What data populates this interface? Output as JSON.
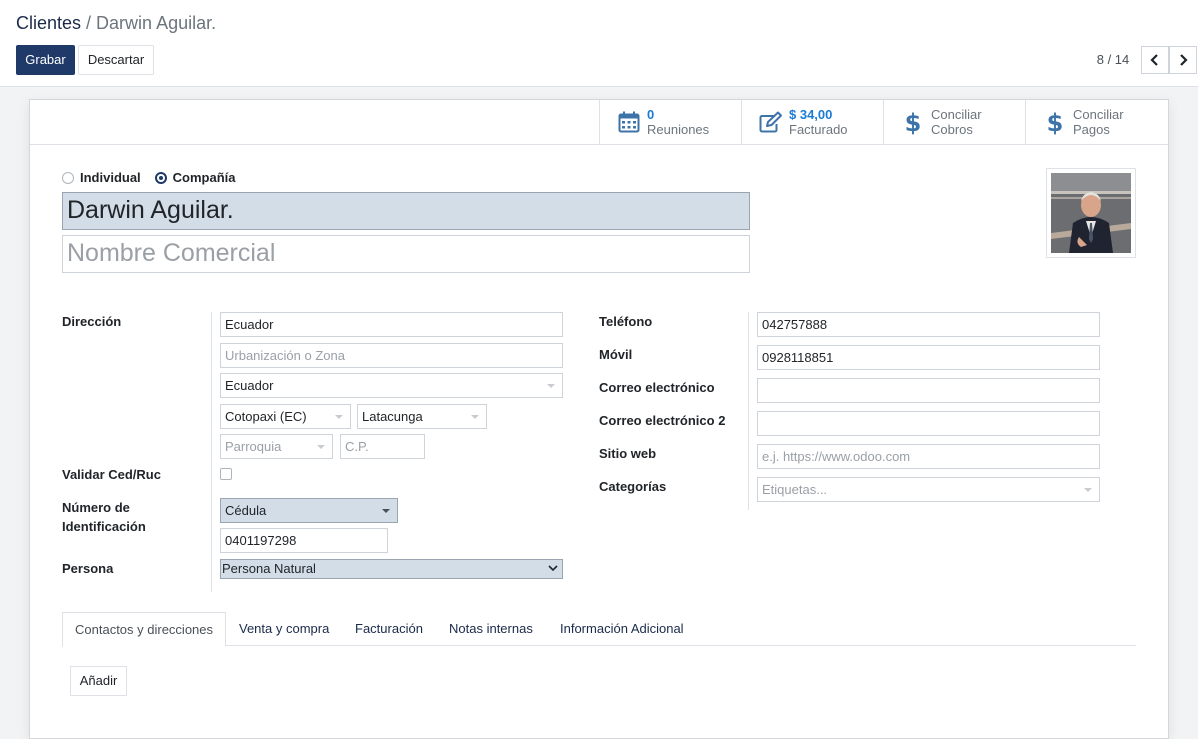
{
  "breadcrumb": {
    "parent": "Clientes",
    "separator": " / ",
    "current": "Darwin Aguilar."
  },
  "toolbar": {
    "save_label": "Grabar",
    "discard_label": "Descartar"
  },
  "pager": {
    "value": "8 / 14",
    "prev_icon": "chevron-left-icon",
    "next_icon": "chevron-right-icon"
  },
  "stat_buttons": [
    {
      "value": "0",
      "label": "Reuniones",
      "icon": "calendar-icon"
    },
    {
      "value": "$ 34,00",
      "label": "Facturado",
      "icon": "edit-icon"
    },
    {
      "line1": "Conciliar",
      "line2": "Cobros",
      "icon": "dollar-icon"
    },
    {
      "line1": "Conciliar",
      "line2": "Pagos",
      "icon": "dollar-icon"
    }
  ],
  "company_type": {
    "individual_label": "Individual",
    "company_label": "Compañía",
    "selected": "Compañía"
  },
  "name": "Darwin Aguilar.",
  "trade_name_placeholder": "Nombre Comercial",
  "address": {
    "label": "Dirección",
    "street": "Ecuador",
    "street2_placeholder": "Urbanización o Zona",
    "country": "Ecuador",
    "state": "Cotopaxi (EC)",
    "city": "Latacunga",
    "parish_placeholder": "Parroquia",
    "zip_placeholder": "C.P."
  },
  "validate": {
    "label": "Validar Ced/Ruc",
    "checked": false
  },
  "identification": {
    "label": "Número de Identificación",
    "type": "Cédula",
    "number": "0401197298"
  },
  "person": {
    "label": "Persona",
    "value": "Persona Natural"
  },
  "contact": {
    "phone_label": "Teléfono",
    "phone": "042757888",
    "mobile_label": "Móvil",
    "mobile": "0928118851",
    "email_label": "Correo electrónico",
    "email": "",
    "email2_label": "Correo electrónico 2",
    "email2": "",
    "website_label": "Sitio web",
    "website_placeholder": "e.j. https://www.odoo.com",
    "categories_label": "Categorías",
    "categories_placeholder": "Etiquetas..."
  },
  "tabs": [
    "Contactos y direcciones",
    "Venta y compra",
    "Facturación",
    "Notas internas",
    "Información Adicional"
  ],
  "active_tab": "Contactos y direcciones",
  "add_label": "Añadir",
  "colors": {
    "primary": "#1f3a68",
    "stat_value": "#1c7bd4",
    "required_field": "#d2dde8"
  }
}
